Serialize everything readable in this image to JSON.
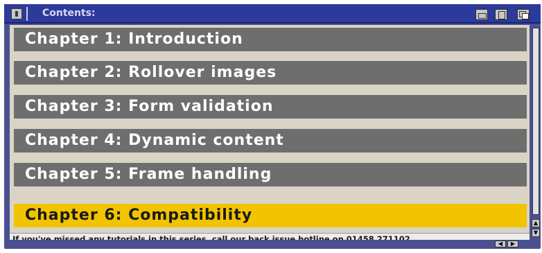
{
  "window": {
    "title": "Contents:",
    "accent": "#2c3a9c"
  },
  "chapters": [
    {
      "label": "Chapter 1: Introduction",
      "active": false
    },
    {
      "label": "Chapter 2: Rollover images",
      "active": false
    },
    {
      "label": "Chapter 3: Form validation",
      "active": false
    },
    {
      "label": "Chapter 4: Dynamic content",
      "active": false
    },
    {
      "label": "Chapter 5: Frame handling",
      "active": false
    },
    {
      "label": "Chapter 6: Compatibility",
      "active": true
    }
  ],
  "footer": {
    "text": "If you've missed any tutorials in this series, call our back issue hotline on 01458 271102."
  },
  "colors": {
    "chapter_bg": "#6e6e6e",
    "active_bg": "#f2c400",
    "content_bg": "#d9d4c6"
  },
  "icons": {
    "close": "close-gadget-icon",
    "iconify": "iconify-gadget-icon",
    "zoom": "zoom-gadget-icon",
    "depth": "depth-gadget-icon",
    "scroll_up": "arrow-up-icon",
    "scroll_down": "arrow-down-icon",
    "scroll_left": "arrow-left-icon",
    "scroll_right": "arrow-right-icon"
  }
}
